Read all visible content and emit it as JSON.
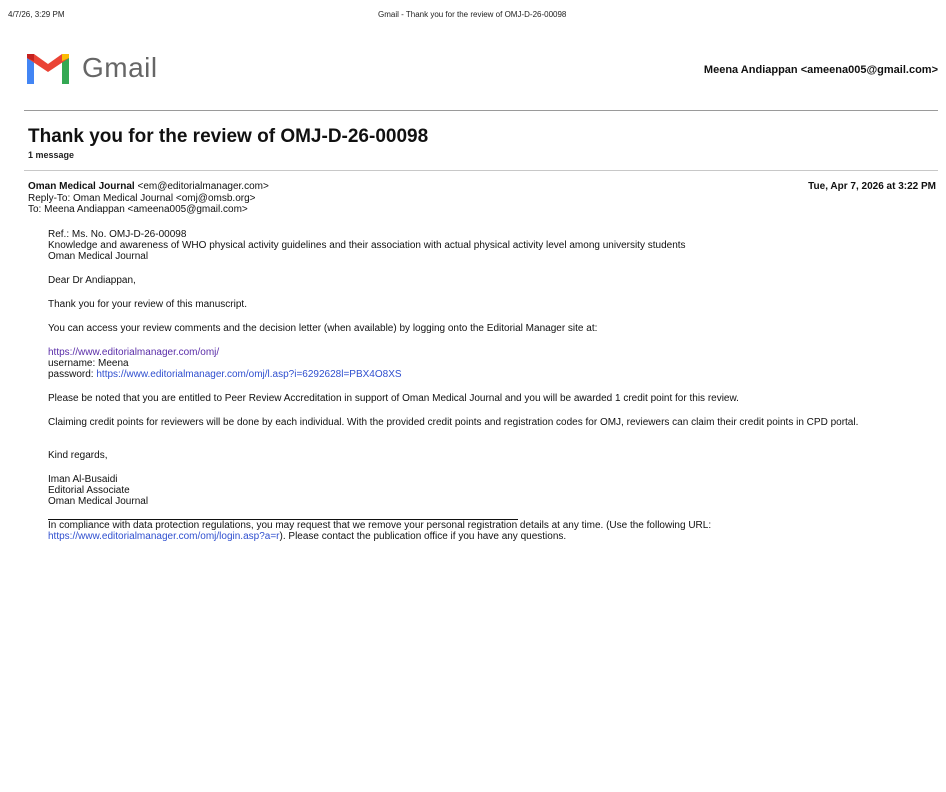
{
  "print_header": {
    "date": "4/7/26, 3:29 PM",
    "title": "Gmail - Thank you for the review of OMJ-D-26-00098"
  },
  "brand": {
    "wordmark": "Gmail",
    "icon": "gmail-m-icon",
    "colors": {
      "red": "#ea4335",
      "blue": "#4285f4",
      "green": "#34a853",
      "yellow": "#fbbc04",
      "darkred": "#c5221f"
    }
  },
  "account": "Meena Andiappan <ameena005@gmail.com>",
  "thread": {
    "subject": "Thank you for the review of OMJ-D-26-00098",
    "count": "1 message"
  },
  "message": {
    "from_label": "Oman Medical Journal",
    "from_addr": "<em@editorialmanager.com>",
    "reply_to_label": "Reply-To:",
    "reply_to": "Oman Medical Journal <omj@omsb.org>",
    "to_label": "To:",
    "to": "Meena Andiappan <ameena005@gmail.com>",
    "date": "Tue, Apr 7, 2026 at 3:22 PM"
  },
  "body": {
    "ref": "Ref.:  Ms. No. OMJ-D-26-00098",
    "article_title": "Knowledge and awareness of WHO physical activity guidelines and their association with actual physical activity level among university students",
    "journal": "Oman Medical Journal",
    "greeting": "Dear Dr Andiappan,",
    "thanks": "Thank you for your review of this manuscript.",
    "access": "You can access your review comments and the decision letter (when available) by logging onto the Editorial Manager site at:",
    "site_link": "https://www.editorialmanager.com/omj/",
    "username_line": "username: Meena",
    "password_label": "password:",
    "password_link": "https://www.editorialmanager.com/omj/l.asp?i=6292628l=PBX4O8XS",
    "accreditation": "Please be noted that you are entitled to Peer Review Accreditation in support of Oman Medical Journal and you will be awarded 1 credit point for this review.",
    "claiming": "Claiming credit points for reviewers will be done by each individual. With the provided credit points and registration codes for OMJ, reviewers can claim their credit points in CPD portal.",
    "closing": "Kind regards,",
    "sig_name": "Iman Al-Busaidi",
    "sig_title": "Editorial Associate",
    "sig_org": "Oman Medical Journal"
  },
  "footer": {
    "text1": "In compliance with data protection regulations, you may request that we remove your personal registration details at any time.  (Use the following URL:",
    "link": "https://www.editorialmanager.com/omj/login.asp?a=r",
    "text2": "). Please contact the publication office if you have any questions."
  }
}
